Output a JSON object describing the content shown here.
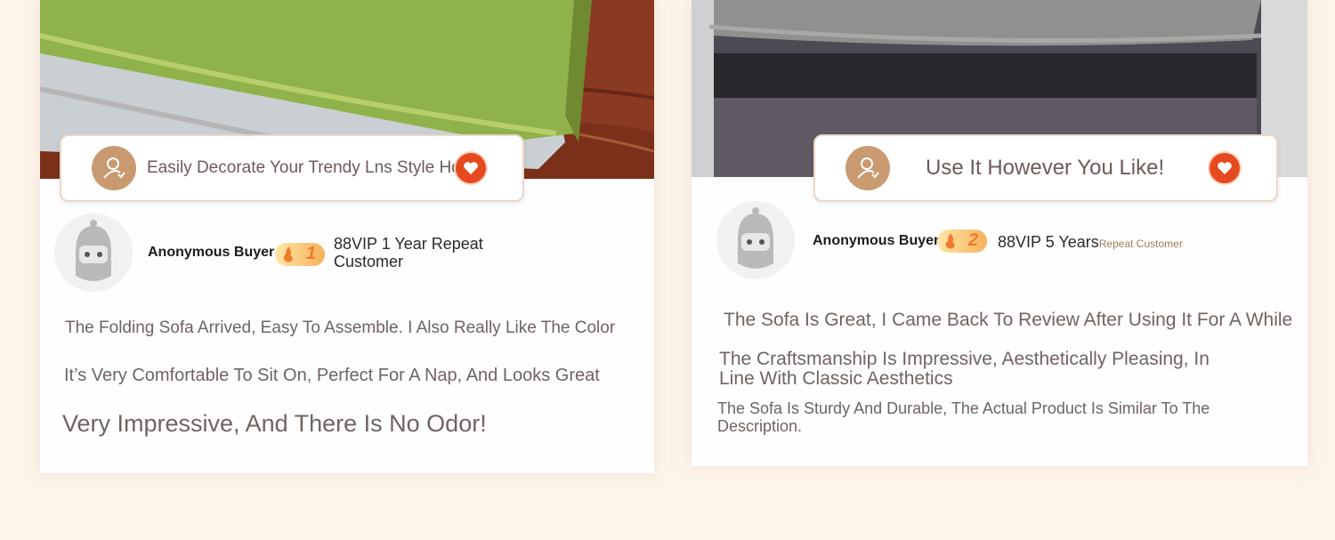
{
  "cards": [
    {
      "title": "Easily Decorate Your Trendy Lns Style Home",
      "buyer": "Anonymous Buyer",
      "vip_level": "1",
      "vip_text": "88VIP 1 Year Repeat Customer",
      "reviews": [
        "The Folding Sofa Arrived, Easy To Assemble. I Also Really Like The Color",
        "It’s Very Comfortable To Sit On, Perfect For A Nap, And Looks Great",
        "Very Impressive, And There Is No Odor!"
      ]
    },
    {
      "title": "Use It However You Like!",
      "buyer": "Anonymous Buyer",
      "vip_level": "2",
      "vip_text": "88VIP 5 Years",
      "vip_sub": "Repeat Customer",
      "reviews": [
        "The Sofa Is Great, I Came Back To Review After Using It For A While",
        "The Craftsmanship Is Impressive, Aesthetically Pleasing, In Line With Classic Aesthetics",
        "The Sofa Is Sturdy And Durable, The Actual Product Is Similar To The Description."
      ]
    }
  ],
  "colors": {
    "page_bg": "#fdf4ea",
    "heart": "#e64a1f",
    "user_icon": "#c99a70",
    "sofa_green": "#8fb24a",
    "floor_wood": "#8a3a22",
    "sofa_grey": "#8e918d"
  }
}
